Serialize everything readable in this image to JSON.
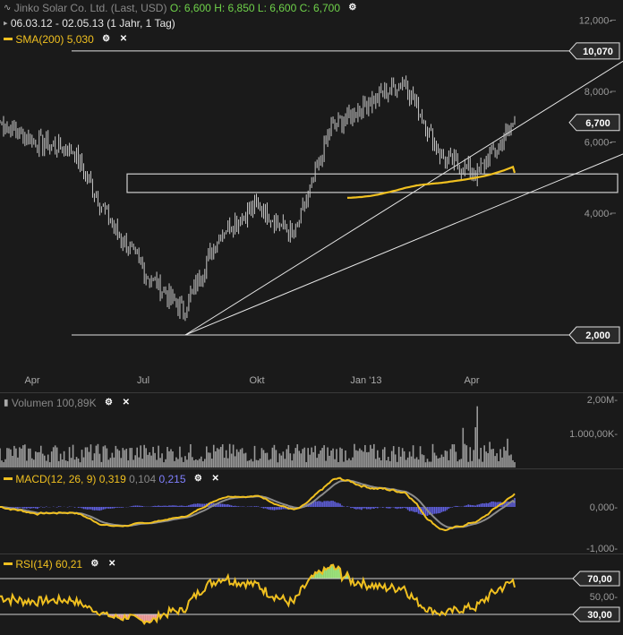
{
  "header": {
    "title": "Jinko Solar Co. Ltd. (Last, USD)",
    "ohlc": {
      "open": "O: 6,600",
      "high": "H: 6,850",
      "low": "L: 6,600",
      "close": "C: 6,700"
    },
    "date_range": "06.03.12 - 02.05.13 (1 Jahr, 1 Tag)",
    "sma_label": "SMA(200)",
    "sma_value": "5,030"
  },
  "price_pane": {
    "y_ticks": [
      "12,000",
      "8,000",
      "6,000",
      "4,000"
    ],
    "level_labels": {
      "resistance": "10,070",
      "last": "6,700",
      "support": "2,000"
    },
    "x_ticks": [
      "Apr",
      "Jul",
      "Okt",
      "Jan '13",
      "Apr"
    ]
  },
  "volume_pane": {
    "label": "Volumen",
    "value": "100,89K",
    "y_ticks": [
      "2,00M",
      "1.000,00K"
    ]
  },
  "macd_pane": {
    "label": "MACD(12, 26, 9)",
    "v1": "0,319",
    "v2": "0,104",
    "v3": "0,215",
    "y_ticks": [
      "0,000",
      "-1,000"
    ]
  },
  "rsi_pane": {
    "label": "RSI(14)",
    "value": "60,21",
    "y_ticks": [
      "70,00",
      "50,00",
      "30,00"
    ]
  },
  "colors": {
    "background": "#1a1a1a",
    "candle_up": "#d8d8d8",
    "sma": "#f0c020",
    "macd_hist": "#6060e0",
    "signal": "#8c8c8c",
    "rsi_over": "#9be07a",
    "rsi_under": "#f0a0a0"
  },
  "chart_data": [
    {
      "type": "candlestick",
      "title": "Jinko Solar Co. Ltd. (Last, USD)",
      "y_scale": "log",
      "ylim": [
        1.6,
        13
      ],
      "x_ticks": [
        "Apr",
        "Jul",
        "Okt",
        "Jan '13",
        "Apr"
      ],
      "close_series": [
        {
          "month": "Mar 12",
          "value": 6.7
        },
        {
          "month": "Apr 12",
          "value": 6.0
        },
        {
          "month": "May 12",
          "value": 5.7
        },
        {
          "month": "Jun 12",
          "value": 3.8
        },
        {
          "month": "Jul 12",
          "value": 2.8
        },
        {
          "month": "Aug 12",
          "value": 2.3
        },
        {
          "month": "Sep 12",
          "value": 3.6
        },
        {
          "month": "Oct 12",
          "value": 4.2
        },
        {
          "month": "Nov 12",
          "value": 3.5
        },
        {
          "month": "Dec 12",
          "value": 6.5
        },
        {
          "month": "Jan 13",
          "value": 7.5
        },
        {
          "month": "Feb 13",
          "value": 8.5
        },
        {
          "month": "Mar 13",
          "value": 5.5
        },
        {
          "month": "Apr 13",
          "value": 5.0
        },
        {
          "month": "May 13",
          "value": 6.7
        }
      ],
      "levels": {
        "resistance": 10.07,
        "support": 2.0,
        "last": 6.7
      },
      "sma200_current": 5.03
    },
    {
      "type": "bar",
      "name": "Volumen",
      "last": "100,89K",
      "ylim": [
        0,
        2000000
      ],
      "peak": 1800000
    },
    {
      "type": "line",
      "name": "MACD(12, 26, 9)",
      "values": {
        "macd": 0.319,
        "signal": 0.104,
        "histogram": 0.215
      }
    },
    {
      "type": "line",
      "name": "RSI(14)",
      "last": 60.21,
      "bands": [
        30,
        70
      ]
    }
  ]
}
